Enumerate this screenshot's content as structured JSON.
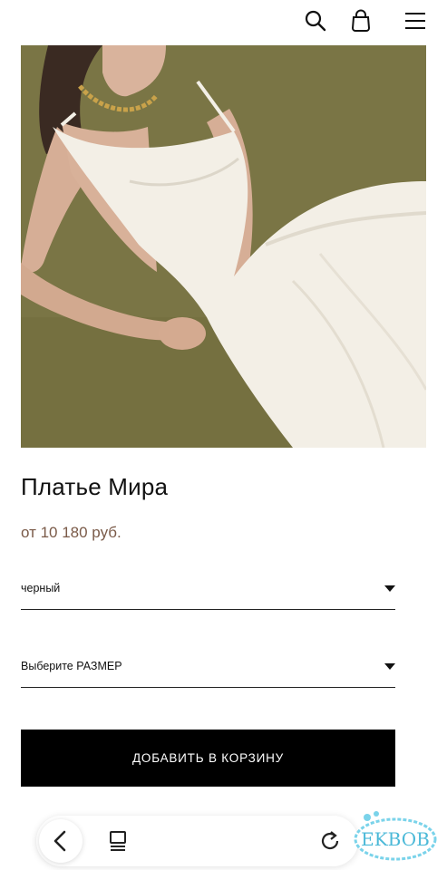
{
  "header": {
    "search_icon": "search-icon",
    "bag_icon": "shopping-bag-icon",
    "menu_icon": "hamburger-menu-icon"
  },
  "product": {
    "title": "Платье Мира",
    "price": "от 10 180 руб.",
    "color_select": {
      "value": "черный"
    },
    "size_select": {
      "value": "Выберите РАЗМЕР"
    },
    "add_to_cart_label": "ДОБАВИТЬ В КОРЗИНУ"
  },
  "browser_nav": {
    "back_icon": "chevron-left-icon",
    "tabs_icon": "tabs-icon",
    "reload_icon": "reload-icon"
  },
  "watermark": {
    "text": "EKBOB"
  },
  "colors": {
    "background": "#ffffff",
    "button": "#000000",
    "price": "#7a5a48",
    "photo_backdrop": "#777244"
  }
}
